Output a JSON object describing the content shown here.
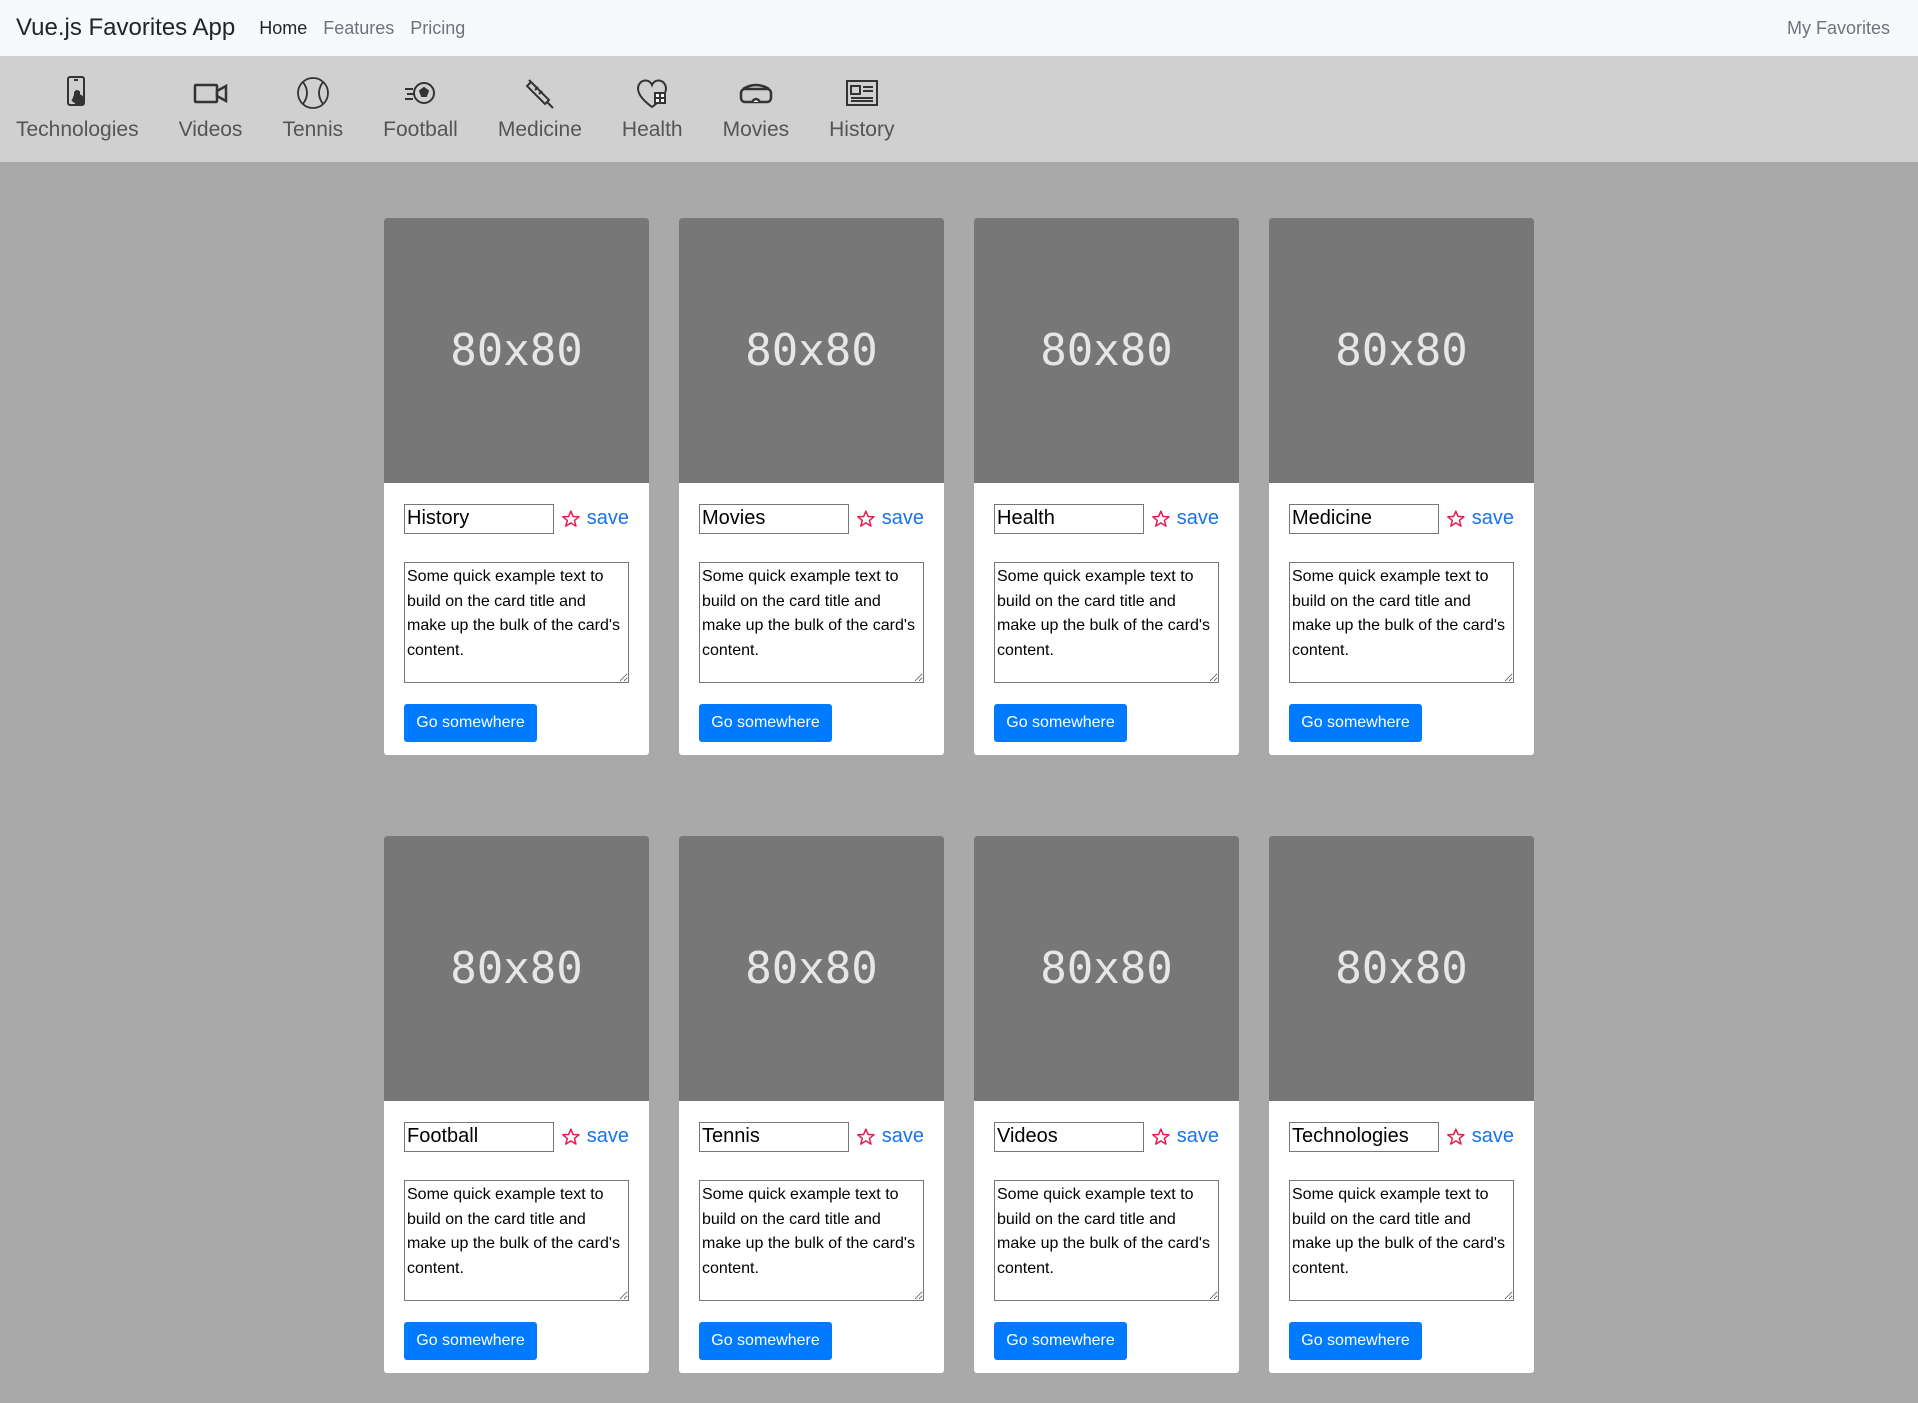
{
  "navbar": {
    "brand": "Vue.js Favorites App",
    "links": [
      "Home",
      "Features",
      "Pricing"
    ],
    "right": "My Favorites"
  },
  "categories": [
    {
      "label": "Technologies",
      "icon": "touch-phone-icon"
    },
    {
      "label": "Videos",
      "icon": "video-camera-icon"
    },
    {
      "label": "Tennis",
      "icon": "tennis-ball-icon"
    },
    {
      "label": "Football",
      "icon": "football-icon"
    },
    {
      "label": "Medicine",
      "icon": "syringe-icon"
    },
    {
      "label": "Health",
      "icon": "heart-plus-icon"
    },
    {
      "label": "Movies",
      "icon": "vr-glasses-icon"
    },
    {
      "label": "History",
      "icon": "newspaper-icon"
    }
  ],
  "cards": [
    {
      "image_text": "80x80",
      "title": "History",
      "save": "save",
      "text": "Some quick example text to build on the card title and make up the bulk of the card's content.",
      "button": "Go somewhere"
    },
    {
      "image_text": "80x80",
      "title": "Movies",
      "save": "save",
      "text": "Some quick example text to build on the card title and make up the bulk of the card's content.",
      "button": "Go somewhere"
    },
    {
      "image_text": "80x80",
      "title": "Health",
      "save": "save",
      "text": "Some quick example text to build on the card title and make up the bulk of the card's content.",
      "button": "Go somewhere"
    },
    {
      "image_text": "80x80",
      "title": "Medicine",
      "save": "save",
      "text": "Some quick example text to build on the card title and make up the bulk of the card's content.",
      "button": "Go somewhere"
    },
    {
      "image_text": "80x80",
      "title": "Football",
      "save": "save",
      "text": "Some quick example text to build on the card title and make up the bulk of the card's content.",
      "button": "Go somewhere"
    },
    {
      "image_text": "80x80",
      "title": "Tennis",
      "save": "save",
      "text": "Some quick example text to build on the card title and make up the bulk of the card's content.",
      "button": "Go somewhere"
    },
    {
      "image_text": "80x80",
      "title": "Videos",
      "save": "save",
      "text": "Some quick example text to build on the card title and make up the bulk of the card's content.",
      "button": "Go somewhere"
    },
    {
      "image_text": "80x80",
      "title": "Technologies",
      "save": "save",
      "text": "Some quick example text to build on the card title and make up the bulk of the card's content.",
      "button": "Go somewhere"
    }
  ],
  "colors": {
    "accent": "#007bff",
    "star": "#e8194f",
    "page_bg": "#a9a9a9",
    "category_bar": "#d0d0d0",
    "thumb_bg": "#777777"
  }
}
